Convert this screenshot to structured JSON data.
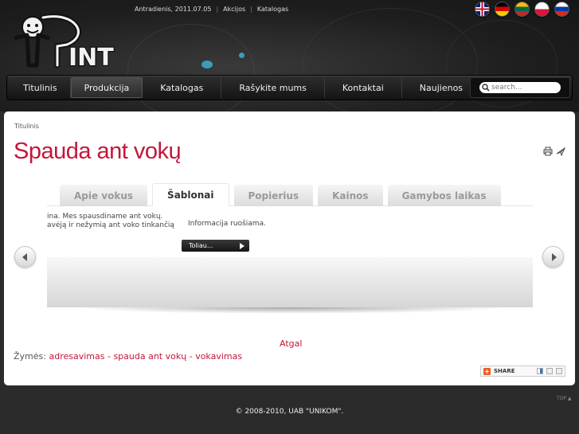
{
  "topbar": {
    "date": "Antradienis, 2011.07.05",
    "links": [
      "Akcijos",
      "Katalogas"
    ]
  },
  "flags": [
    "English",
    "Deutsch",
    "Lietuvių",
    "Polski",
    "Русский"
  ],
  "nav": {
    "items": [
      {
        "label": "Titulinis"
      },
      {
        "label": "Produkcija"
      },
      {
        "label": "Katalogas"
      },
      {
        "label": "Rašykite mums"
      },
      {
        "label": "Kontaktai"
      },
      {
        "label": "Naujienos"
      }
    ],
    "active_index": 1,
    "search_placeholder": "search..."
  },
  "breadcrumb": "Titulinis",
  "page_title": "Spauda ant vokų",
  "tabs": {
    "items": [
      "Apie vokus",
      "Šablonai",
      "Popierius",
      "Kainos",
      "Gamybos laikas"
    ],
    "active_index": 1
  },
  "slide": {
    "left_text_line1": "ina. Mes spausdiname ant vokų.",
    "left_text_line2": "avėją ir nežymią ant voko tinkančią",
    "info_text": "Informacija ruošiama.",
    "more_label": "Toliau..."
  },
  "back_label": "Atgal",
  "tags": {
    "label": "Žymės:",
    "items": [
      "adresavimas",
      "spauda ant vokų",
      "vokavimas"
    ]
  },
  "share_label": "SHARE",
  "top_label": "TOP ▲",
  "footer": "© 2008-2010, UAB \"UNIKOM\"."
}
